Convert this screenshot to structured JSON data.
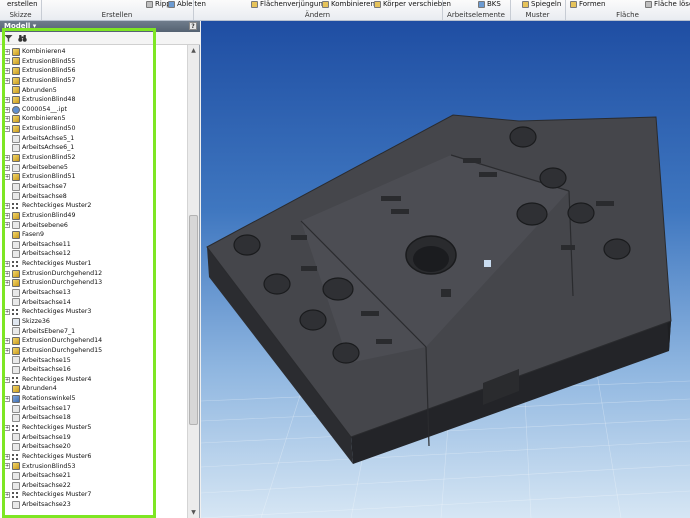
{
  "ribbon": {
    "items": [
      {
        "label": "erstellen",
        "icon": "sketch-icon"
      },
      {
        "label": "Rippe",
        "icon": "rib-icon"
      },
      {
        "label": "Ableiten",
        "icon": "derive-icon"
      },
      {
        "label": "Flächenverjüngung",
        "icon": "face-draft-icon"
      },
      {
        "label": "Kombinieren",
        "icon": "combine-icon"
      },
      {
        "label": "Körper verschieben",
        "icon": "move-body-icon"
      },
      {
        "label": "BKS",
        "icon": "ucs-icon"
      },
      {
        "label": "Spiegeln",
        "icon": "mirror-icon"
      },
      {
        "label": "Formen",
        "icon": "sculpt-icon"
      },
      {
        "label": "Fläche lösch",
        "icon": "delete-face-icon"
      }
    ],
    "groups": [
      "Skizze",
      "Erstellen",
      "Ändern",
      "Arbeitselemente",
      "Muster",
      "Fläche"
    ]
  },
  "panel": {
    "title": "Modell",
    "title_arrow": "▾",
    "help": "?",
    "filter_icon": "filter-icon",
    "find_icon": "binoculars-icon"
  },
  "tree": [
    {
      "label": "Kombinieren4",
      "type": "feat",
      "expand": "+"
    },
    {
      "label": "ExtrusionBlind55",
      "type": "feat",
      "expand": "+"
    },
    {
      "label": "ExtrusionBlind56",
      "type": "feat",
      "expand": "+"
    },
    {
      "label": "ExtrusionBlind57",
      "type": "feat",
      "expand": "+"
    },
    {
      "label": "Abrunden5",
      "type": "feat",
      "expand": ""
    },
    {
      "label": "ExtrusionBlind48",
      "type": "feat",
      "expand": "+"
    },
    {
      "label": "C000054__.ipt",
      "type": "part",
      "expand": "+"
    },
    {
      "label": "Kombinieren5",
      "type": "feat",
      "expand": "+"
    },
    {
      "label": "ExtrusionBlind50",
      "type": "feat",
      "expand": "+"
    },
    {
      "label": "ArbeitsAchse5_1",
      "type": "work",
      "expand": ""
    },
    {
      "label": "ArbeitsAchse6_1",
      "type": "work",
      "expand": ""
    },
    {
      "label": "ExtrusionBlind52",
      "type": "feat",
      "expand": "+"
    },
    {
      "label": "Arbeitsebene5",
      "type": "work",
      "expand": "+"
    },
    {
      "label": "ExtrusionBlind51",
      "type": "feat",
      "expand": "+"
    },
    {
      "label": "Arbeitsachse7",
      "type": "work",
      "expand": ""
    },
    {
      "label": "Arbeitsachse8",
      "type": "work",
      "expand": ""
    },
    {
      "label": "Rechteckiges Muster2",
      "type": "patt",
      "expand": "+"
    },
    {
      "label": "ExtrusionBlind49",
      "type": "feat",
      "expand": "+"
    },
    {
      "label": "Arbeitsebene6",
      "type": "work",
      "expand": "+"
    },
    {
      "label": "Fasen9",
      "type": "feat",
      "expand": ""
    },
    {
      "label": "Arbeitsachse11",
      "type": "work",
      "expand": ""
    },
    {
      "label": "Arbeitsachse12",
      "type": "work",
      "expand": ""
    },
    {
      "label": "Rechteckiges Muster1",
      "type": "patt",
      "expand": "+"
    },
    {
      "label": "ExtrusionDurchgehend12",
      "type": "feat",
      "expand": "+"
    },
    {
      "label": "ExtrusionDurchgehend13",
      "type": "feat",
      "expand": "+"
    },
    {
      "label": "Arbeitsachse13",
      "type": "work",
      "expand": ""
    },
    {
      "label": "Arbeitsachse14",
      "type": "work",
      "expand": ""
    },
    {
      "label": "Rechteckiges Muster3",
      "type": "patt",
      "expand": "+"
    },
    {
      "label": "Skizze36",
      "type": "sketch",
      "expand": ""
    },
    {
      "label": "ArbeitsEbene7_1",
      "type": "work",
      "expand": ""
    },
    {
      "label": "ExtrusionDurchgehend14",
      "type": "feat",
      "expand": "+"
    },
    {
      "label": "ExtrusionDurchgehend15",
      "type": "feat",
      "expand": "+"
    },
    {
      "label": "Arbeitsachse15",
      "type": "work",
      "expand": ""
    },
    {
      "label": "Arbeitsachse16",
      "type": "work",
      "expand": ""
    },
    {
      "label": "Rechteckiges Muster4",
      "type": "patt",
      "expand": "+"
    },
    {
      "label": "Abrunden4",
      "type": "feat",
      "expand": ""
    },
    {
      "label": "Rotationswinkel5",
      "type": "rot",
      "expand": "+"
    },
    {
      "label": "Arbeitsachse17",
      "type": "work",
      "expand": ""
    },
    {
      "label": "Arbeitsachse18",
      "type": "work",
      "expand": ""
    },
    {
      "label": "Rechteckiges Muster5",
      "type": "patt",
      "expand": "+"
    },
    {
      "label": "Arbeitsachse19",
      "type": "work",
      "expand": ""
    },
    {
      "label": "Arbeitsachse20",
      "type": "work",
      "expand": ""
    },
    {
      "label": "Rechteckiges Muster6",
      "type": "patt",
      "expand": "+"
    },
    {
      "label": "ExtrusionBlind53",
      "type": "feat",
      "expand": "+"
    },
    {
      "label": "Arbeitsachse21",
      "type": "work",
      "expand": ""
    },
    {
      "label": "Arbeitsachse22",
      "type": "work",
      "expand": ""
    },
    {
      "label": "Rechteckiges Muster7",
      "type": "patt",
      "expand": "+"
    },
    {
      "label": "Arbeitsachse23",
      "type": "work",
      "expand": ""
    }
  ],
  "colors": {
    "highlight": "#7ee623",
    "model": "#3a3b3f",
    "viewport_top": "#1f4ea3",
    "viewport_bottom": "#d6e6f4"
  }
}
